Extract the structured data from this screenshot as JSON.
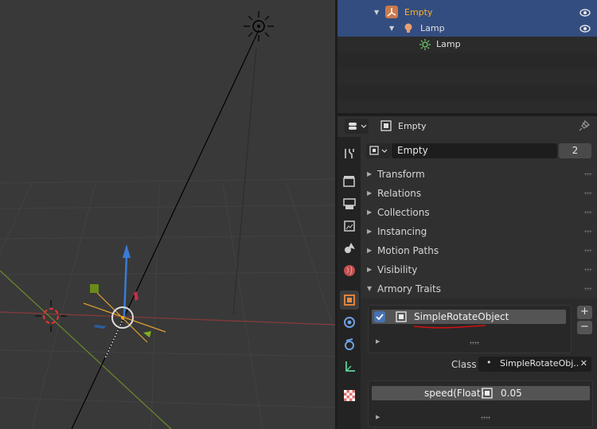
{
  "outliner": {
    "rows": [
      {
        "label": "Empty"
      },
      {
        "label": "Lamp"
      },
      {
        "label": "Lamp"
      }
    ]
  },
  "properties": {
    "header_object": "Empty",
    "data_name": "Empty",
    "user_count": "2",
    "panels": [
      {
        "label": "Transform"
      },
      {
        "label": "Relations"
      },
      {
        "label": "Collections"
      },
      {
        "label": "Instancing"
      },
      {
        "label": "Motion Paths"
      },
      {
        "label": "Visibility"
      },
      {
        "label": "Armory Traits"
      }
    ],
    "traits": {
      "item_name": "SimpleRotateObject",
      "item_checked": true,
      "add_label": "+",
      "remove_label": "−",
      "class_label": "Class",
      "class_value": "SimpleRotateObj..",
      "clear_label": "✕",
      "prop_label": "speed(Float)",
      "prop_value": "0.05"
    }
  },
  "colors": {
    "selection": "#334d80",
    "active_text": "#ffaf29",
    "annotation": "#d11111",
    "gizmo_z": "#3a7bd5"
  },
  "icons": [
    "eye-icon",
    "empty-icon",
    "lamp-icon",
    "sun-icon",
    "tool-icon",
    "render-icon",
    "output-icon",
    "view-layer-icon",
    "scene-icon",
    "world-icon",
    "object-icon",
    "modifier-icon",
    "physics-icon",
    "constraints-icon",
    "texture-icon",
    "pin-icon"
  ]
}
